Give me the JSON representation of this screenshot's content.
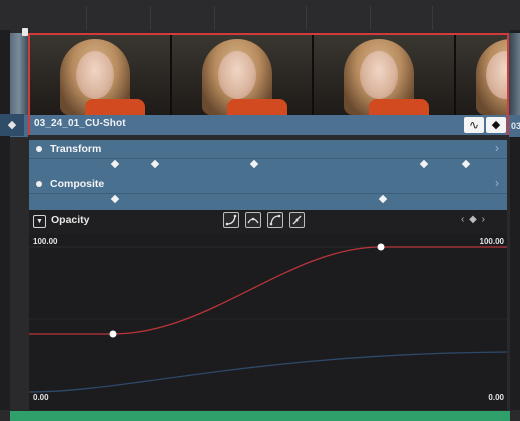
{
  "clip": {
    "name": "03_24_01_CU-Shot",
    "next_clip_label": "03"
  },
  "properties": [
    {
      "label": "Transform"
    },
    {
      "label": "Composite"
    }
  ],
  "opacity": {
    "label": "Opacity",
    "max_left": "100.00",
    "max_right": "100.00",
    "min_left": "0.00",
    "min_right": "0.00"
  },
  "icons": {
    "curve_toggle": "curve-wave-icon",
    "keyframe_toggle": "keyframe-diamond-icon",
    "kf_nav": "‹ ◆ ›"
  },
  "colors": {
    "clip_border": "#d23b3b",
    "clip_blue": "#4c7192",
    "curve_red": "#b9353a",
    "curve_blue": "#2e4a6a",
    "audio_green": "#2fa06a"
  }
}
